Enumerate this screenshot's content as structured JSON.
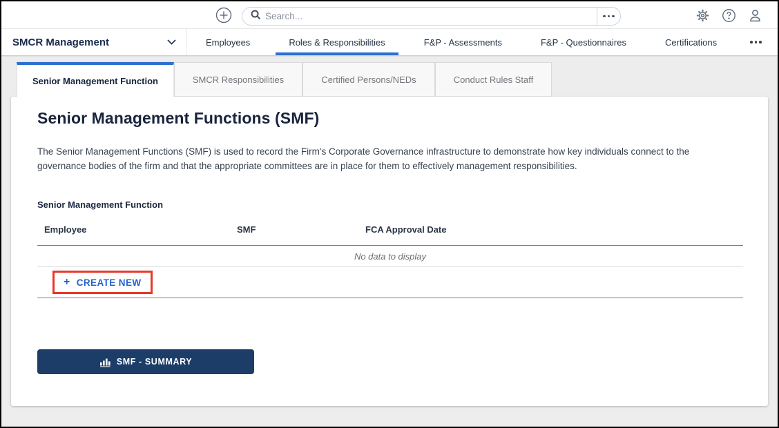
{
  "topbar": {
    "search_placeholder": "Search...",
    "icons": [
      "plus-circle",
      "search-magnifier",
      "search-more-ellipsis",
      "settings-gear",
      "help-question",
      "user-profile"
    ]
  },
  "nav": {
    "app_title": "SMCR Management",
    "items": [
      {
        "label": "Employees",
        "active": false
      },
      {
        "label": "Roles & Responsibilities",
        "active": true
      },
      {
        "label": "F&P - Assessments",
        "active": false
      },
      {
        "label": "F&P - Questionnaires",
        "active": false
      },
      {
        "label": "Certifications",
        "active": false
      }
    ],
    "more": "more-ellipsis"
  },
  "tabs": [
    {
      "label": "Senior Management Function",
      "active": true
    },
    {
      "label": "SMCR Responsibilities",
      "active": false
    },
    {
      "label": "Certified Persons/NEDs",
      "active": false
    },
    {
      "label": "Conduct Rules Staff",
      "active": false
    }
  ],
  "page": {
    "title": "Senior Management Functions (SMF)",
    "description": "The Senior Management Functions (SMF) is used to record the Firm's Corporate Governance infrastructure to demonstrate how key individuals connect to the governance bodies of the firm and that the appropriate committees are in place for them to effectively management responsibilities.",
    "section_label": "Senior Management Function"
  },
  "table": {
    "columns": [
      "Employee",
      "SMF",
      "FCA Approval Date"
    ],
    "rows": [],
    "empty_text": "No data to display",
    "create_new_label": "CREATE NEW",
    "create_new_plus": "+"
  },
  "actions": {
    "summary_button_label": "SMF - SUMMARY",
    "summary_button_icon": "bar-chart"
  },
  "colors": {
    "accent_blue": "#2a6fd2",
    "link_blue": "#2563c9",
    "button_navy": "#1c3d68",
    "highlight_red": "#e8372c",
    "page_background": "#ededee"
  }
}
